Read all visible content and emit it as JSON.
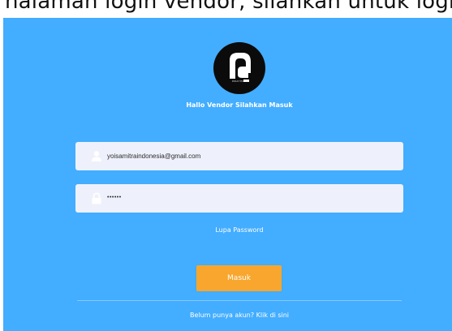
{
  "caption": {
    "text": "halaman login vendor, silahkan untuk login"
  },
  "login": {
    "greeting": "Hallo Vendor Silahkan Masuk",
    "logo_text": "PARAHITA",
    "email": {
      "value": "yoisamitraindonesia@gmail.com",
      "icon": "user-icon"
    },
    "password": {
      "value": "••••••",
      "icon": "lock-icon"
    },
    "forgot_password": "Lupa Password",
    "submit_label": "Masuk",
    "register_prompt": "Belum punya akun? Klik di sini"
  },
  "colors": {
    "background": "#43adff",
    "button": "#f8a62d",
    "field": "#eef1fb",
    "logo": "#0b0b0b"
  }
}
